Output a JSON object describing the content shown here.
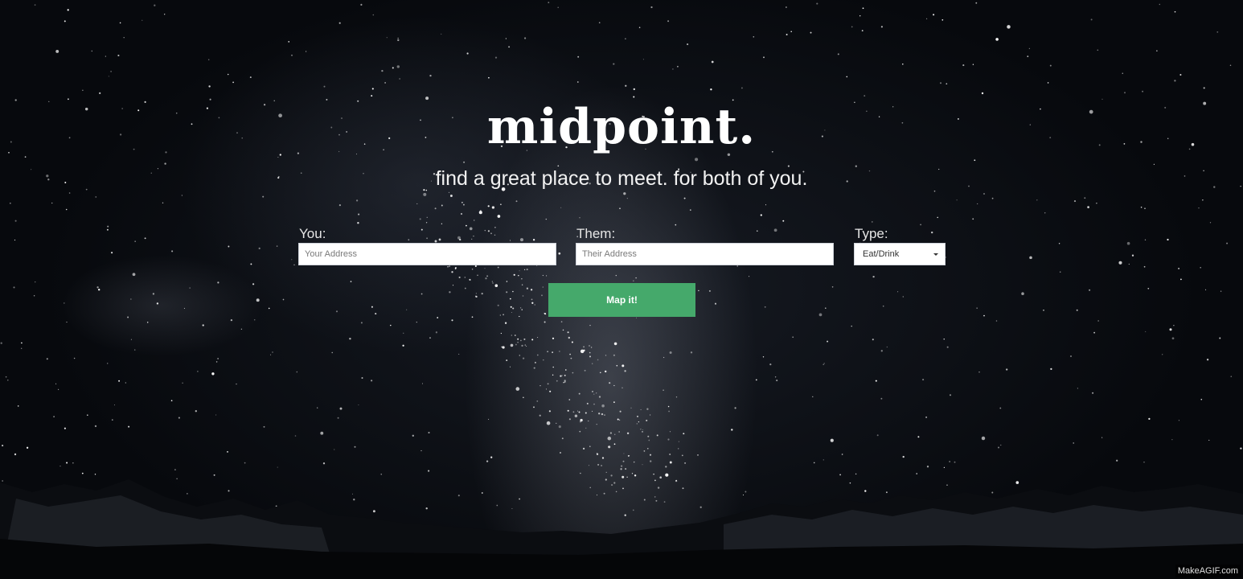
{
  "hero": {
    "logo": "midpoint.",
    "tagline": "find a great place to meet. for both of you."
  },
  "form": {
    "you_label": "You:",
    "you_placeholder": "Your Address",
    "them_label": "Them:",
    "them_placeholder": "Their Address",
    "type_label": "Type:",
    "type_selected": "Eat/Drink",
    "submit_label": "Map it!"
  },
  "watermark": "MakeAGIF.com",
  "colors": {
    "button": "#45a96b",
    "background": "#07090d",
    "text": "#ffffff"
  }
}
